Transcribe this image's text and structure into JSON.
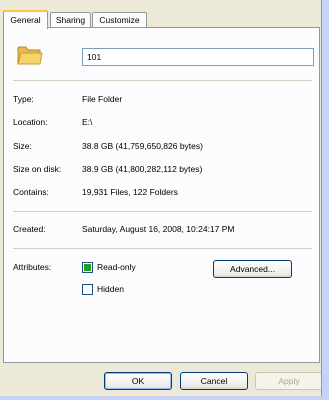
{
  "tabs": [
    {
      "label": "General",
      "active": true
    },
    {
      "label": "Sharing",
      "active": false
    },
    {
      "label": "Customize",
      "active": false
    }
  ],
  "icon": {
    "name": "folder-icon",
    "color": "#f2cf63"
  },
  "name_field": {
    "value": "101"
  },
  "properties": {
    "type": {
      "label": "Type:",
      "value": "File Folder"
    },
    "location": {
      "label": "Location:",
      "value": "E:\\"
    },
    "size": {
      "label": "Size:",
      "value": "38.8 GB (41,759,650,826 bytes)"
    },
    "size_on_disk": {
      "label": "Size on disk:",
      "value": "38.9 GB (41,800,282,112 bytes)"
    },
    "contains": {
      "label": "Contains:",
      "value": "19,931 Files, 122 Folders"
    },
    "created": {
      "label": "Created:",
      "value": "Saturday, August 16, 2008, 10:24:17 PM"
    }
  },
  "attributes": {
    "label": "Attributes:",
    "read_only": {
      "label": "Read-only",
      "checked": true
    },
    "hidden": {
      "label": "Hidden",
      "checked": false
    },
    "advanced_label": "Advanced..."
  },
  "footer": {
    "ok_label": "OK",
    "cancel_label": "Cancel",
    "apply_label": "Apply"
  }
}
